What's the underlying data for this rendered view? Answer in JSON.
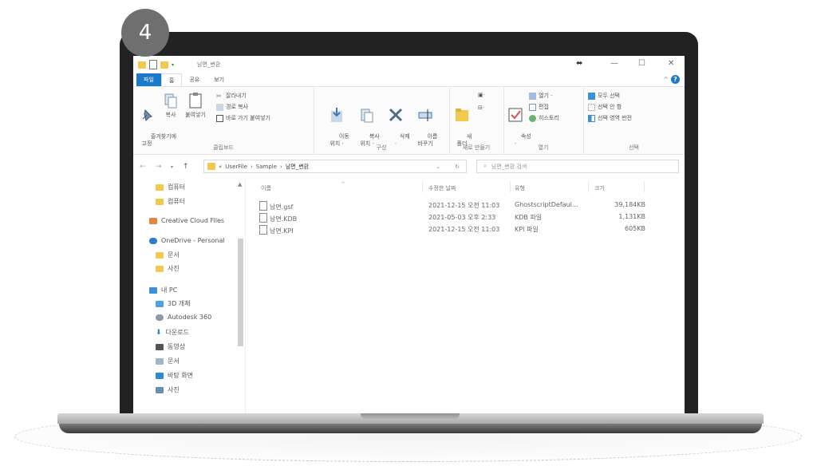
{
  "badge": "4",
  "window": {
    "title": "남면_변환",
    "controls": {
      "pin": "⬌",
      "minimize": "—",
      "maximize": "☐",
      "close": "✕"
    }
  },
  "tabs": [
    "파일",
    "홈",
    "공유",
    "보기"
  ],
  "ribbon": {
    "clipboard": {
      "pin_label": "즐겨찾기에\n고정",
      "copy_label": "복사",
      "paste_label": "붙여넣기",
      "cut_label": "잘라내기",
      "copy_path_label": "경로 복사",
      "paste_shortcut_label": "바로 가기 붙여넣기",
      "group_label": "클립보드"
    },
    "organize": {
      "move_label": "이동\n위치 ·",
      "copy_to_label": "복사\n위치 ·",
      "delete_label": "삭제\n·",
      "rename_label": "이름\n바꾸기",
      "group_label": "구성"
    },
    "new": {
      "new_folder_label": "새\n폴더",
      "group_label": "새로 만들기"
    },
    "open": {
      "properties_label": "속성\n·",
      "open_label": "열기 ·",
      "edit_label": "편집",
      "history_label": "히스토리",
      "group_label": "열기"
    },
    "select": {
      "select_all_label": "모두 선택",
      "select_none_label": "선택 안 함",
      "invert_label": "선택 영역 반전",
      "group_label": "선택"
    }
  },
  "nav_buttons": {
    "back": "←",
    "forward": "→",
    "up": "↑"
  },
  "address": {
    "prefix": "«",
    "parts": [
      "UserFile",
      "Sample",
      "남면_변환"
    ],
    "separator": "›"
  },
  "search": {
    "placeholder": "남면_변환 검색"
  },
  "navpane": {
    "items": [
      {
        "label": "컴퓨터",
        "icon": "folder-icon",
        "color": "#f2c94c"
      },
      {
        "label": "컴퓨터",
        "icon": "folder-icon",
        "color": "#f2c94c"
      },
      {
        "label": "Creative Cloud Files",
        "icon": "creative-cloud-icon",
        "color": "#e8833a"
      },
      {
        "label": "OneDrive - Personal",
        "icon": "onedrive-icon",
        "color": "#2a7bd5"
      },
      {
        "label": "문서",
        "icon": "folder-icon",
        "color": "#f2c94c"
      },
      {
        "label": "사진",
        "icon": "folder-icon",
        "color": "#f2c94c"
      },
      {
        "label": "내 PC",
        "icon": "pc-icon",
        "color": "#3c8fd9"
      },
      {
        "label": "3D 개체",
        "icon": "3d-objects-icon",
        "color": "#4aa3e6"
      },
      {
        "label": "Autodesk 360",
        "icon": "autodesk-icon",
        "color": "#8a9aaa"
      },
      {
        "label": "다운로드",
        "icon": "download-icon",
        "color": "#2a7bd5"
      },
      {
        "label": "동영상",
        "icon": "video-icon",
        "color": "#555555"
      },
      {
        "label": "문서",
        "icon": "document-icon",
        "color": "#9fb7c9"
      },
      {
        "label": "바탕 화면",
        "icon": "desktop-icon",
        "color": "#2a8ad5"
      },
      {
        "label": "사진",
        "icon": "pictures-icon",
        "color": "#6a8fb0"
      }
    ]
  },
  "file_list": {
    "columns": [
      "이름",
      "수정한 날짜",
      "유형",
      "크기"
    ],
    "rows": [
      {
        "name": "남면.gsf",
        "date": "2021-12-15 오전 11:03",
        "type": "GhostscriptDefaul...",
        "size": "39,184KB"
      },
      {
        "name": "남면.KDB",
        "date": "2021-05-03 오후 2:33",
        "type": "KDB 파일",
        "size": "1,131KB"
      },
      {
        "name": "남면.KPI",
        "date": "2021-12-15 오전 11:03",
        "type": "KPI 파일",
        "size": "605KB"
      }
    ]
  }
}
